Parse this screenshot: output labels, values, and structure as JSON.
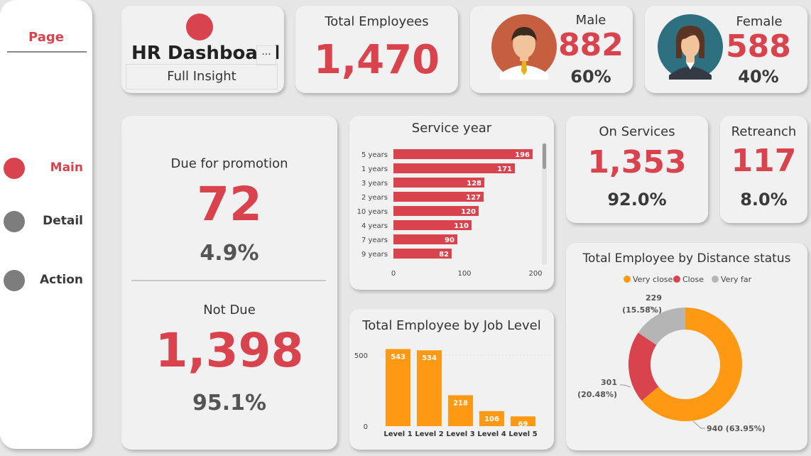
{
  "sidebar": {
    "title": "Page",
    "items": [
      {
        "label": "Main",
        "active": true
      },
      {
        "label": "Detail",
        "active": false
      },
      {
        "label": "Action",
        "active": false
      }
    ]
  },
  "header": {
    "title": "HR Dashboard",
    "subtitle": "Full Insight",
    "more_label": "..."
  },
  "kpis": {
    "total": {
      "label": "Total Employees",
      "value": "1,470"
    },
    "male": {
      "label": "Male",
      "value": "882",
      "pct": "60%"
    },
    "female": {
      "label": "Female",
      "value": "588",
      "pct": "40%"
    },
    "promotion": {
      "label": "Due for promotion",
      "value": "72",
      "pct": "4.9%"
    },
    "not_due": {
      "label": "Not Due",
      "value": "1,398",
      "pct": "95.1%"
    },
    "on_services": {
      "label": "On Services",
      "value": "1,353",
      "pct": "92.0%"
    },
    "retreanch": {
      "label": "Retreanch",
      "value": "117",
      "pct": "8.0%"
    }
  },
  "colors": {
    "accent": "#d9434e",
    "orange": "#ff9913",
    "grey": "#b5b5b5",
    "dark": "#3a3a3a"
  },
  "chart_data": [
    {
      "type": "bar",
      "orientation": "horizontal",
      "title": "Service year",
      "categories": [
        "5 years",
        "1 years",
        "3 years",
        "2 years",
        "10 years",
        "4 years",
        "7 years",
        "9 years"
      ],
      "values": [
        196,
        171,
        128,
        127,
        120,
        110,
        90,
        82
      ],
      "xticks": [
        "0",
        "100",
        "200"
      ],
      "xlim": [
        0,
        200
      ],
      "color": "#d9434e"
    },
    {
      "type": "bar",
      "title": "Total Employee by Job Level",
      "categories": [
        "Level 1",
        "Level 2",
        "Level 3",
        "Level 4",
        "Level 5"
      ],
      "values": [
        543,
        534,
        218,
        106,
        69
      ],
      "yticks": [
        "0",
        "500"
      ],
      "ylim": [
        0,
        600
      ],
      "color": "#ff9913"
    },
    {
      "type": "pie",
      "title": "Total Employee by Distance status",
      "legend": [
        "Very close",
        "Close",
        "Very far"
      ],
      "legend_placement": "top",
      "slices": [
        {
          "name": "Very close",
          "value": 940,
          "label": "940 (63.95%)",
          "color": "#ff9913"
        },
        {
          "name": "Close",
          "value": 301,
          "label": "301",
          "label2": "(20.48%)",
          "color": "#d9434e"
        },
        {
          "name": "Very far",
          "value": 229,
          "label": "229",
          "label2": "(15.58%)",
          "color": "#b5b5b5"
        }
      ]
    }
  ]
}
